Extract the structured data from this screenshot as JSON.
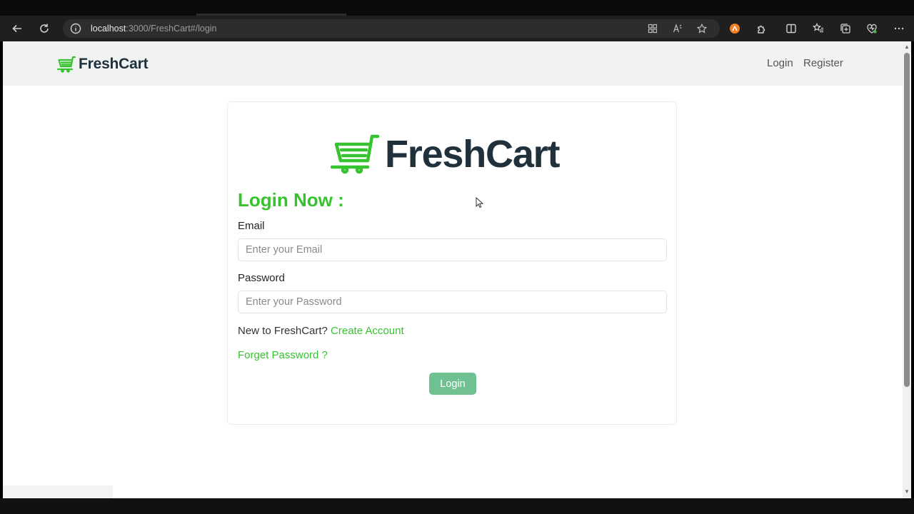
{
  "browser": {
    "url_host": "localhost",
    "url_rest": ":3000/FreshCart#/login",
    "icons": [
      "back-icon",
      "reload-icon",
      "info-icon",
      "apps-icon",
      "read-aloud-icon",
      "favorite-star-icon",
      "extension-orange-icon",
      "extensions-icon",
      "split-screen-icon",
      "favorites-icon",
      "collections-icon",
      "browser-essentials-icon",
      "more-icon"
    ]
  },
  "nav": {
    "brand": "FreshCart",
    "links": [
      "Login",
      "Register"
    ]
  },
  "login": {
    "logo_text": "FreshCart",
    "heading": "Login Now :",
    "email_label": "Email",
    "email_placeholder": "Enter your Email",
    "password_label": "Password",
    "password_placeholder": "Enter your Password",
    "new_prompt": "New to FreshCart?",
    "create_account": "Create Account",
    "forget_password": "Forget Password ?",
    "submit": "Login"
  },
  "colors": {
    "accent_green": "#37c32f",
    "button_green": "#6fc191",
    "brand_dark": "#21313c",
    "nav_bg": "#f0f3f2"
  }
}
